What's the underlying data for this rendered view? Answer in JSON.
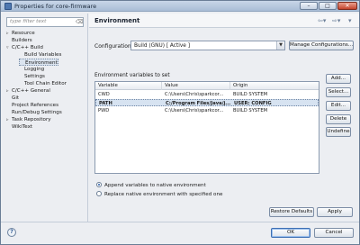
{
  "window": {
    "title": "Properties for core-firmware"
  },
  "filter": {
    "placeholder": "type filter text"
  },
  "tree": [
    {
      "label": "Resource",
      "arrow": "▹",
      "indent": 0
    },
    {
      "label": "Builders",
      "arrow": "",
      "indent": 0
    },
    {
      "label": "C/C++ Build",
      "arrow": "▿",
      "indent": 0
    },
    {
      "label": "Build Variables",
      "arrow": "",
      "indent": 1
    },
    {
      "label": "Environment",
      "arrow": "",
      "indent": 1,
      "selected": true
    },
    {
      "label": "Logging",
      "arrow": "",
      "indent": 1
    },
    {
      "label": "Settings",
      "arrow": "",
      "indent": 1
    },
    {
      "label": "Tool Chain Editor",
      "arrow": "",
      "indent": 1
    },
    {
      "label": "C/C++ General",
      "arrow": "▹",
      "indent": 0
    },
    {
      "label": "Git",
      "arrow": "",
      "indent": 0
    },
    {
      "label": "Project References",
      "arrow": "",
      "indent": 0
    },
    {
      "label": "Run/Debug Settings",
      "arrow": "",
      "indent": 0
    },
    {
      "label": "Task Repository",
      "arrow": "▹",
      "indent": 0
    },
    {
      "label": "WikiText",
      "arrow": "",
      "indent": 0
    }
  ],
  "page": {
    "title": "Environment"
  },
  "configuration": {
    "label": "Configuration:",
    "value": "Build (GNU)  [ Active ]",
    "manage_button": "Manage Configurations..."
  },
  "variables": {
    "label": "Environment variables to set",
    "columns": [
      "Variable",
      "Value",
      "Origin"
    ],
    "rows": [
      {
        "variable": "CWD",
        "value": "C:\\Users\\Chris\\sparkcor...",
        "origin": "BUILD SYSTEM",
        "selected": false
      },
      {
        "variable": "PATH",
        "value": "C:/Program Files/Java/j...",
        "origin": "USER: CONFIG",
        "selected": true
      },
      {
        "variable": "PWD",
        "value": "C:\\Users\\Chris\\sparkcor...",
        "origin": "BUILD SYSTEM",
        "selected": false
      }
    ]
  },
  "side_buttons": {
    "add": "Add...",
    "select": "Select...",
    "edit": "Edit...",
    "delete": "Delete",
    "undefine": "Undefine"
  },
  "options": {
    "append": "Append variables to native environment",
    "replace": "Replace native environment with specified one",
    "selected": "append"
  },
  "page_buttons": {
    "restore": "Restore Defaults",
    "apply": "Apply"
  },
  "dialog_buttons": {
    "ok": "OK",
    "cancel": "Cancel"
  },
  "icons": {
    "help": "question-mark",
    "filter_clear": "clear",
    "back": "back-arrow",
    "forward": "forward-arrow"
  }
}
